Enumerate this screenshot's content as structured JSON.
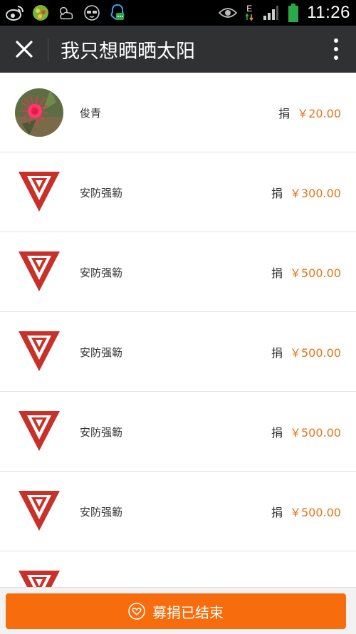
{
  "status_bar": {
    "time": "11:26",
    "network_type": "E",
    "left_icons": [
      "weibo-icon",
      "game-icon",
      "weather-icon",
      "glasses-icon",
      "qq-icon"
    ],
    "right_icons": [
      "eye-icon",
      "data-arrows-icon",
      "signal-icon",
      "battery-icon"
    ]
  },
  "appbar": {
    "title": "我只想晒晒太阳"
  },
  "donors": [
    {
      "name": "俊青",
      "label": "捐",
      "amount": "￥20.00",
      "avatar": "flower-photo"
    },
    {
      "name": "安防强簕",
      "label": "捐",
      "amount": "￥300.00",
      "avatar": "red-v-logo"
    },
    {
      "name": "安防强簕",
      "label": "捐",
      "amount": "￥500.00",
      "avatar": "red-v-logo"
    },
    {
      "name": "安防强簕",
      "label": "捐",
      "amount": "￥500.00",
      "avatar": "red-v-logo"
    },
    {
      "name": "安防强簕",
      "label": "捐",
      "amount": "￥500.00",
      "avatar": "red-v-logo"
    },
    {
      "name": "安防强簕",
      "label": "捐",
      "amount": "￥500.00",
      "avatar": "red-v-logo"
    },
    {
      "name": "",
      "label": "",
      "amount": "",
      "avatar": "red-v-logo"
    }
  ],
  "footer": {
    "button_label": "募捐已结束"
  },
  "colors": {
    "accent_orange": "#f76d0d",
    "amount_orange": "#e8751a",
    "appbar": "#2f3132",
    "logo_red": "#c8312a"
  }
}
